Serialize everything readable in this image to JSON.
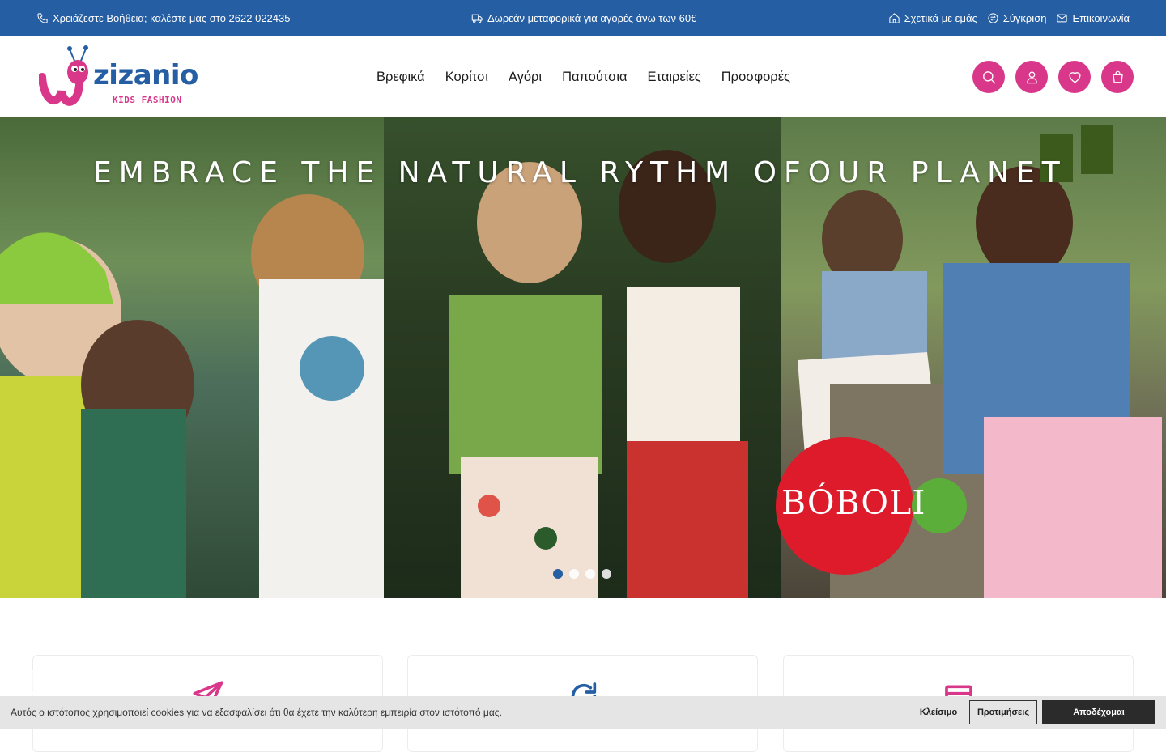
{
  "topbar": {
    "help_text": "Χρειάζεστε Βοήθεια; καλέστε μας στο 2622 022435",
    "shipping_text": "Δωρεάν μεταφορικά για αγορές άνω των 60€",
    "links": {
      "about": "Σχετικά με εμάς",
      "compare": "Σύγκριση",
      "contact": "Επικοινωνία"
    },
    "bg_color": "#255ea3"
  },
  "header": {
    "logo_word": "zizanio",
    "logo_sub": "KIDS FASHION",
    "nav": [
      "Βρεφικά",
      "Κορίτσι",
      "Αγόρι",
      "Παπούτσια",
      "Εταιρείες",
      "Προσφορές"
    ],
    "icons": [
      "search-icon",
      "user-icon",
      "heart-icon",
      "cart-icon"
    ],
    "accent_color": "#d8378a"
  },
  "hero": {
    "headline": "EMBRACE THE NATURAL RYTHM OFOUR PLANET",
    "brand": "BÓBOLI",
    "slide_count": 4,
    "active_slide": 1
  },
  "features": {
    "icons": [
      "paper-plane-icon",
      "refresh-icon",
      "credit-card-icon"
    ]
  },
  "cookie": {
    "text": "Αυτός ο ιστότοπος χρησιμοποιεί cookies για να εξασφαλίσει ότι θα έχετε την καλύτερη εμπειρία στον ιστότοπό μας.",
    "close": "Κλείσιμο",
    "preferences": "Προτιμήσεις",
    "accept": "Αποδέχομαι"
  }
}
